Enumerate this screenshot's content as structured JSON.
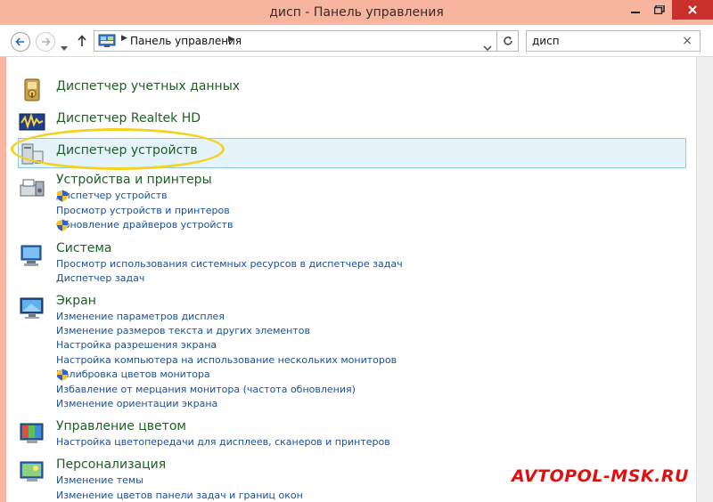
{
  "window": {
    "title": "дисп - Панель управления"
  },
  "navbar": {
    "address_root": "Панель управления",
    "search_value": "дисп"
  },
  "results": [
    {
      "title": "Диспетчер учетных данных",
      "icon": "credential-manager-icon",
      "links": []
    },
    {
      "title": "Диспетчер Realtek HD",
      "icon": "realtek-audio-icon",
      "links": []
    },
    {
      "title": "Диспетчер устройств",
      "icon": "device-manager-icon",
      "links": []
    },
    {
      "title": "Устройства и принтеры",
      "icon": "devices-printers-icon",
      "links": [
        {
          "text": "Диспетчер устройств",
          "shield": true
        },
        {
          "text": "Просмотр устройств и принтеров",
          "shield": false
        },
        {
          "text": "Обновление драйверов устройств",
          "shield": true
        }
      ]
    },
    {
      "title": "Система",
      "icon": "system-icon",
      "links": [
        {
          "text": "Просмотр использования системных ресурсов в диспетчере задач",
          "shield": false
        },
        {
          "text": "Диспетчер задач",
          "shield": false
        }
      ]
    },
    {
      "title": "Экран",
      "icon": "display-icon",
      "links": [
        {
          "text": "Изменение параметров дисплея",
          "shield": false
        },
        {
          "text": "Изменение размеров текста и других элементов",
          "shield": false
        },
        {
          "text": "Настройка разрешения экрана",
          "shield": false
        },
        {
          "text": "Настройка компьютера на использование нескольких мониторов",
          "shield": false
        },
        {
          "text": "Калибровка цветов монитора",
          "shield": true
        },
        {
          "text": "Избавление от мерцания монитора (частота обновления)",
          "shield": false
        },
        {
          "text": "Изменение ориентации экрана",
          "shield": false
        }
      ]
    },
    {
      "title": "Управление цветом",
      "icon": "color-management-icon",
      "links": [
        {
          "text": "Настройка цветопередачи для дисплеев, сканеров и принтеров",
          "shield": false
        }
      ]
    },
    {
      "title": "Персонализация",
      "icon": "personalization-icon",
      "links": [
        {
          "text": "Изменение темы",
          "shield": false
        },
        {
          "text": "Изменение цветов панели задач и границ окон",
          "shield": false
        }
      ]
    }
  ],
  "selected_result": "Диспетчер устройств",
  "watermark": "AVTOPOL-MSK.RU",
  "colors": {
    "title_bar": "#f7b49e",
    "group_title": "#1f5e25",
    "link": "#1b4f9a",
    "selection": "#e5f3fb",
    "highlight_ellipse": "#f4d21f",
    "watermark": "#e01010"
  }
}
